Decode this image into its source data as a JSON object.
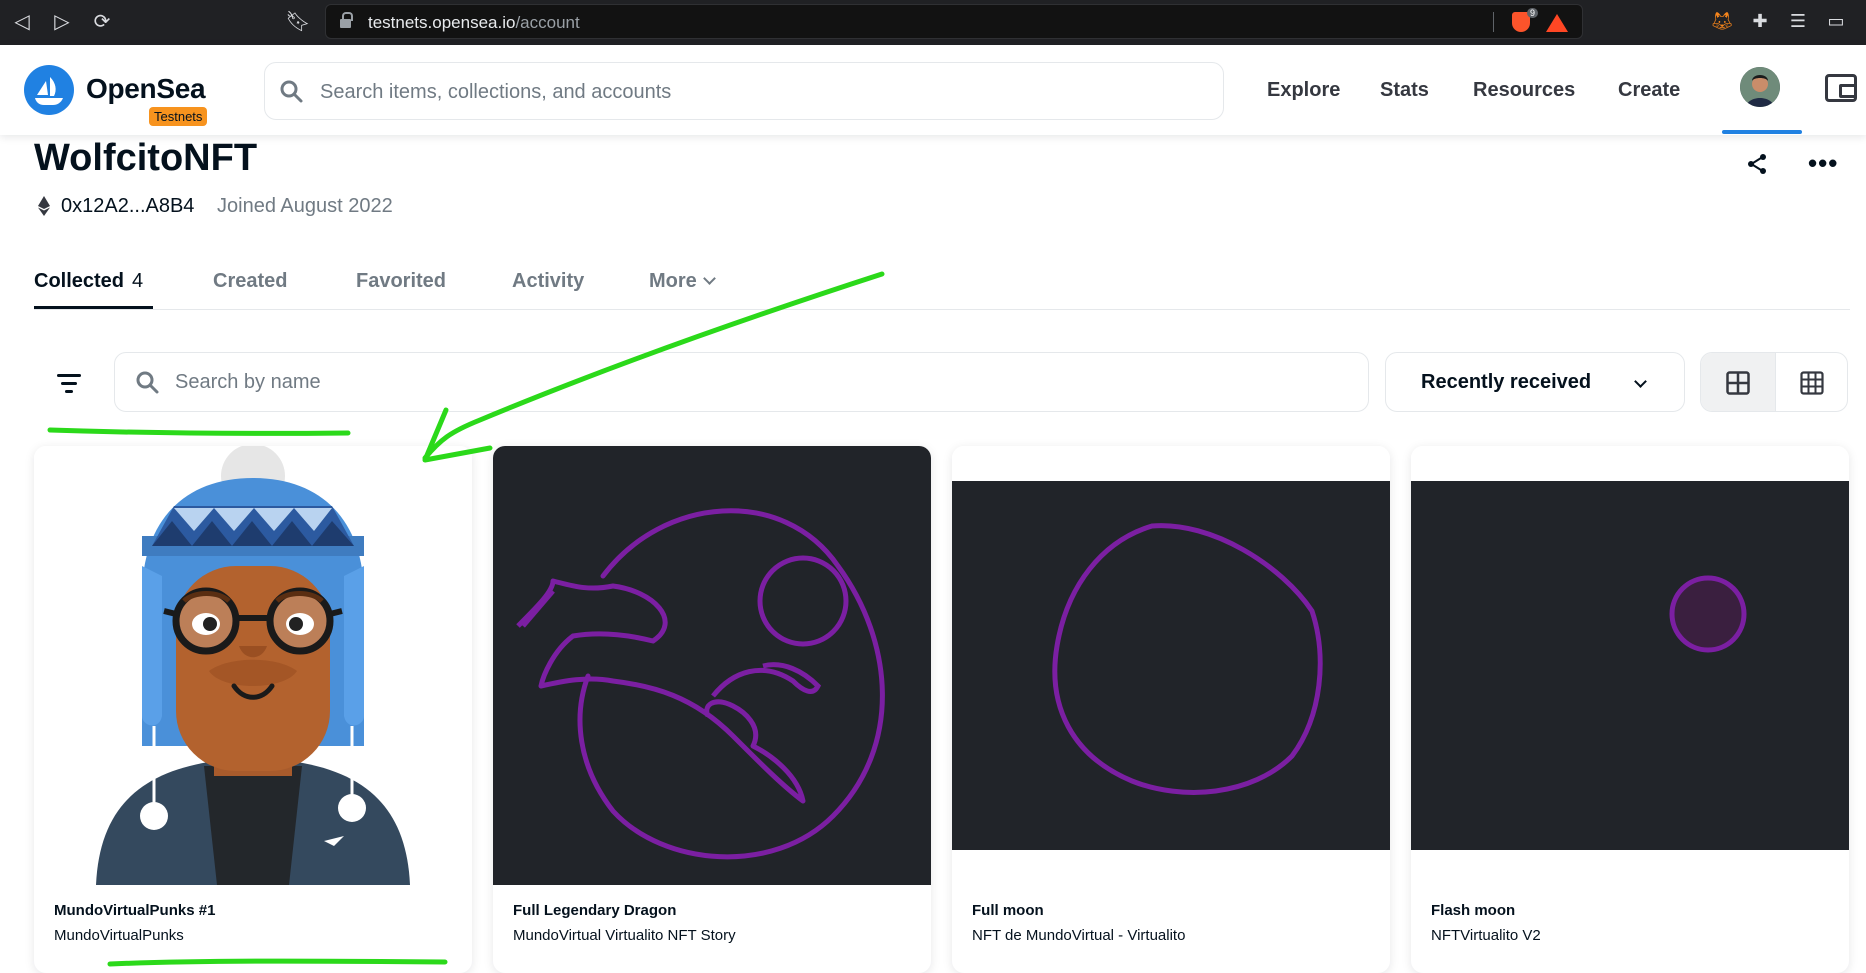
{
  "browser": {
    "url_host": "testnets.opensea.io",
    "url_path": "/account",
    "brave_badge": "9"
  },
  "header": {
    "brand": "OpenSea",
    "badge": "Testnets",
    "search_placeholder": "Search items, collections, and accounts",
    "nav": [
      "Explore",
      "Stats",
      "Resources",
      "Create"
    ]
  },
  "profile": {
    "name": "WolfcitoNFT",
    "address": "0x12A2...A8B4",
    "joined": "Joined August 2022"
  },
  "tabs": [
    {
      "label": "Collected",
      "count": "4"
    },
    {
      "label": "Created"
    },
    {
      "label": "Favorited"
    },
    {
      "label": "Activity"
    },
    {
      "label": "More"
    }
  ],
  "toolbar": {
    "search_placeholder": "Search by name",
    "sort_label": "Recently received"
  },
  "items": [
    {
      "name": "MundoVirtualPunks #1",
      "collection": "MundoVirtualPunks"
    },
    {
      "name": "Full Legendary Dragon",
      "collection": "MundoVirtual Virtualito NFT Story"
    },
    {
      "name": "Full moon",
      "collection": "NFT de MundoVirtual - Virtualito"
    },
    {
      "name": "Flash moon",
      "collection": "NFTVirtualito V2"
    }
  ],
  "colors": {
    "accent": "#2081e2",
    "testnets_badge": "#f7931e",
    "nft_background": "#212429",
    "nft_stroke": "#7b1fa2",
    "annotation": "#2bd91a"
  }
}
